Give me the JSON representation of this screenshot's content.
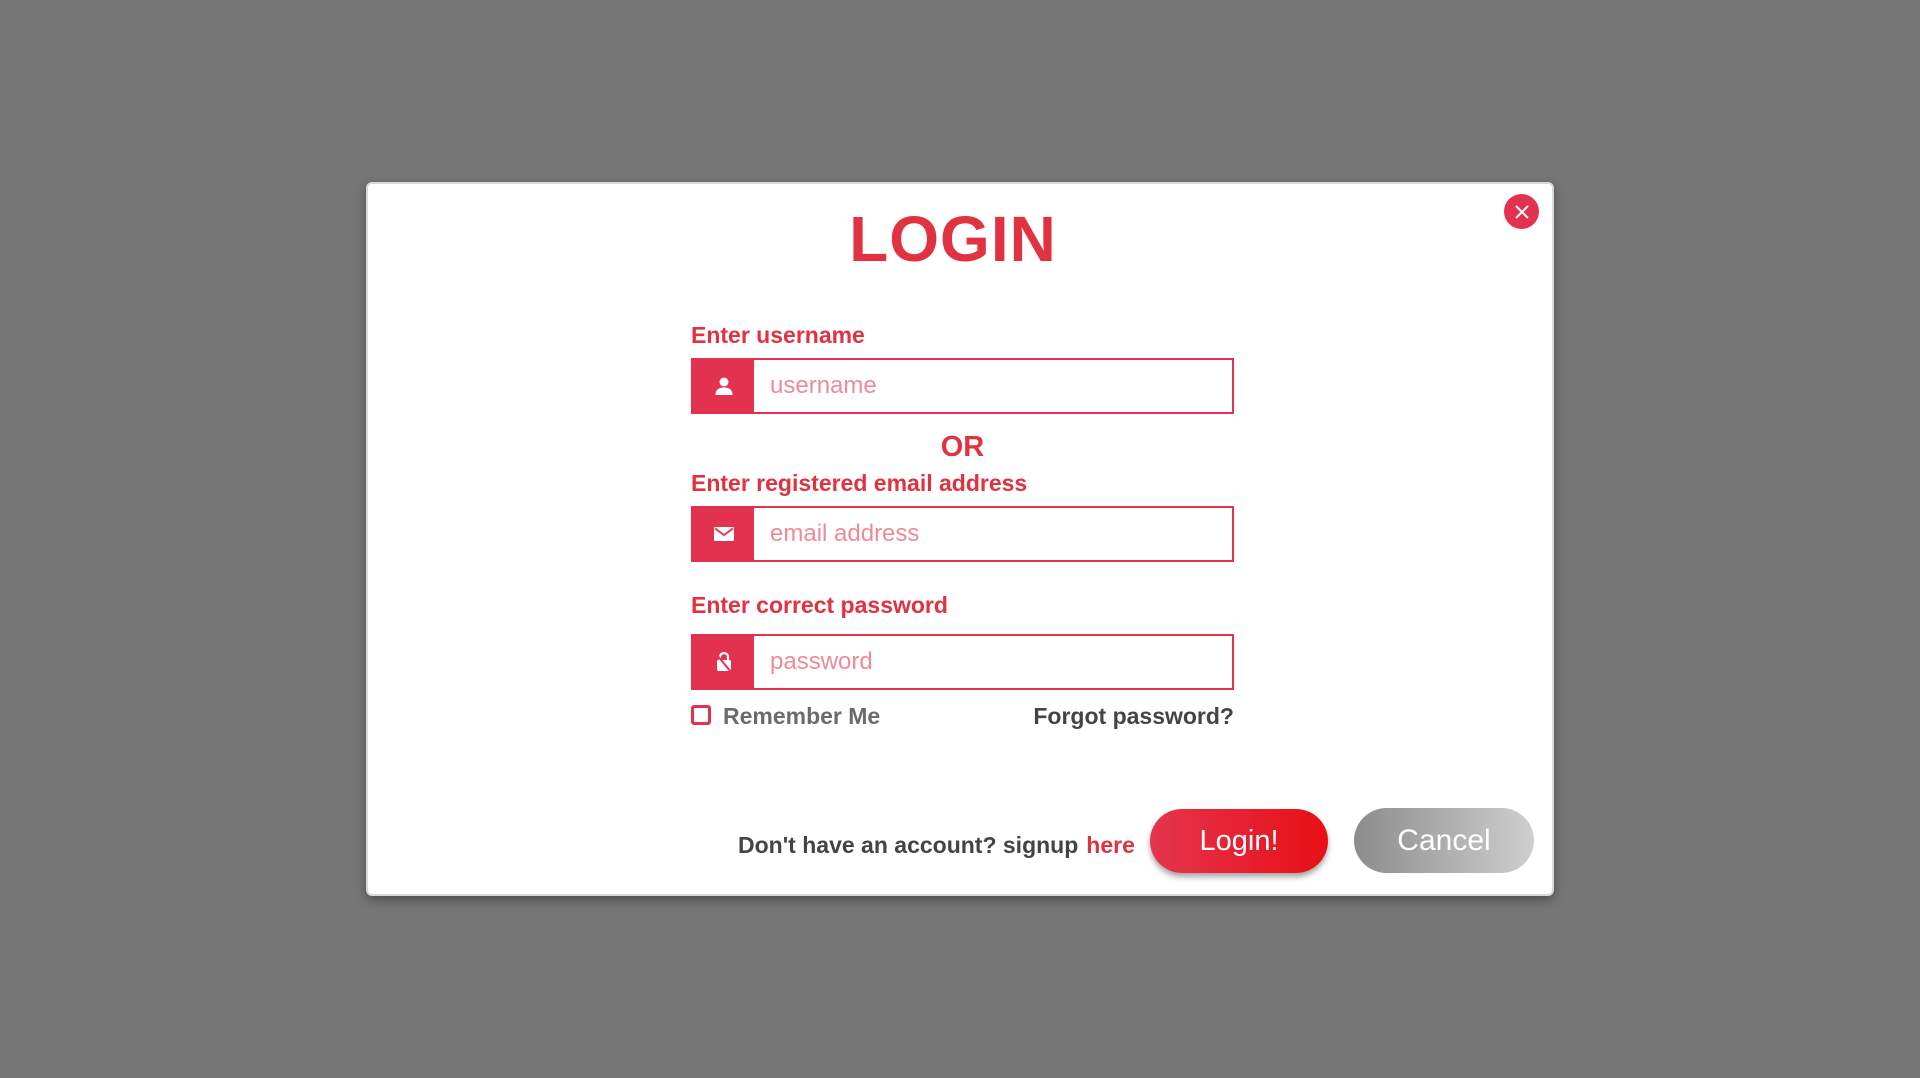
{
  "modal": {
    "title": "LOGIN",
    "close_icon": "close-icon"
  },
  "form": {
    "username": {
      "label": "Enter username",
      "placeholder": "username",
      "value": "",
      "icon": "user-icon"
    },
    "or_text": "OR",
    "email": {
      "label": "Enter registered email address",
      "placeholder": "email address",
      "value": "",
      "icon": "mail-icon"
    },
    "password": {
      "label": "Enter correct password",
      "placeholder": "password",
      "value": "",
      "icon": "lock-icon"
    },
    "remember_me": {
      "label": "Remember Me",
      "checked": false
    },
    "forgot_password": "Forgot password?"
  },
  "footer": {
    "signup_prompt": "Don't have an account? signup",
    "signup_link": "here",
    "login_button": "Login!",
    "cancel_button": "Cancel"
  },
  "colors": {
    "accent": "#e3324f",
    "title": "#e03241",
    "backdrop": "#767676",
    "placeholder": "#ee8a9b"
  }
}
